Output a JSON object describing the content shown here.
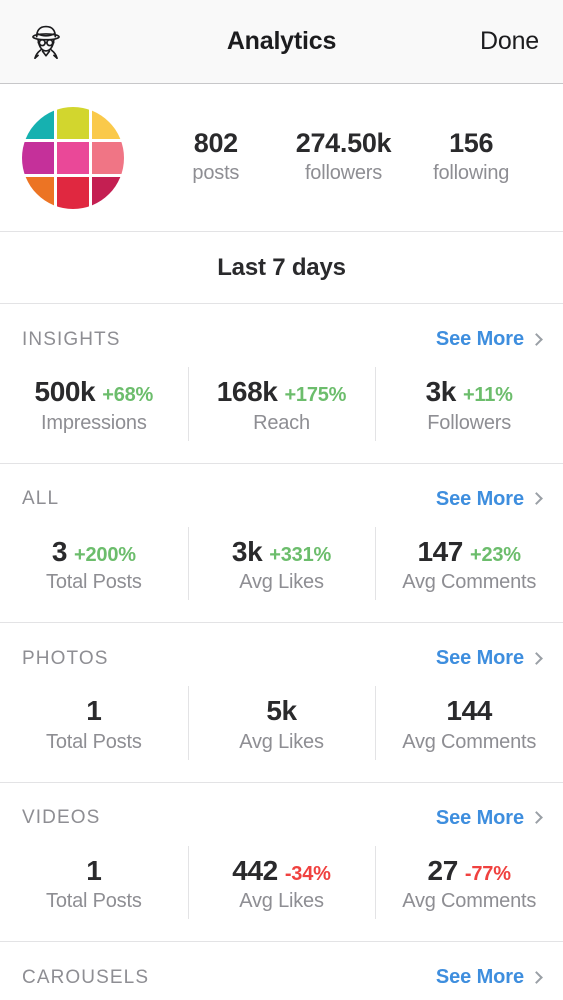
{
  "navbar": {
    "icon_name": "incognito-icon",
    "title": "Analytics",
    "done_label": "Done"
  },
  "profile": {
    "avatar_name": "profile-avatar",
    "avatar_colors": [
      "#16b1b0",
      "#d2d62e",
      "#fac94a",
      "#c5309a",
      "#ea4898",
      "#f07585",
      "#ec7424",
      "#e02840",
      "#c41f52"
    ],
    "stats": [
      {
        "value": "802",
        "label": "posts"
      },
      {
        "value": "274.50k",
        "label": "followers"
      },
      {
        "value": "156",
        "label": "following"
      }
    ]
  },
  "period": {
    "label": "Last 7 days"
  },
  "see_more_label": "See More",
  "colors": {
    "accent_blue": "#3e8ede",
    "delta_up_green": "#6cbd6c",
    "delta_down_red": "#f0413f",
    "muted_gray": "#8e8e93",
    "text_dark": "#2a2a2c"
  },
  "sections": [
    {
      "id": "insights",
      "title": "INSIGHTS",
      "see_more": "See More",
      "metrics": [
        {
          "value": "500k",
          "delta": "+68%",
          "delta_dir": "up",
          "caption": "Impressions"
        },
        {
          "value": "168k",
          "delta": "+175%",
          "delta_dir": "up",
          "caption": "Reach"
        },
        {
          "value": "3k",
          "delta": "+11%",
          "delta_dir": "up",
          "caption": "Followers"
        }
      ]
    },
    {
      "id": "all",
      "title": "ALL",
      "see_more": "See More",
      "metrics": [
        {
          "value": "3",
          "delta": "+200%",
          "delta_dir": "up",
          "caption": "Total Posts"
        },
        {
          "value": "3k",
          "delta": "+331%",
          "delta_dir": "up",
          "caption": "Avg Likes"
        },
        {
          "value": "147",
          "delta": "+23%",
          "delta_dir": "up",
          "caption": "Avg Comments"
        }
      ]
    },
    {
      "id": "photos",
      "title": "PHOTOS",
      "see_more": "See More",
      "metrics": [
        {
          "value": "1",
          "delta": "",
          "delta_dir": "",
          "caption": "Total Posts"
        },
        {
          "value": "5k",
          "delta": "",
          "delta_dir": "",
          "caption": "Avg Likes"
        },
        {
          "value": "144",
          "delta": "",
          "delta_dir": "",
          "caption": "Avg Comments"
        }
      ]
    },
    {
      "id": "videos",
      "title": "VIDEOS",
      "see_more": "See More",
      "metrics": [
        {
          "value": "1",
          "delta": "",
          "delta_dir": "",
          "caption": "Total Posts"
        },
        {
          "value": "442",
          "delta": "-34%",
          "delta_dir": "down",
          "caption": "Avg Likes"
        },
        {
          "value": "27",
          "delta": "-77%",
          "delta_dir": "down",
          "caption": "Avg Comments"
        }
      ]
    },
    {
      "id": "carousels",
      "title": "CAROUSELS",
      "see_more": "See More",
      "metrics": []
    }
  ]
}
